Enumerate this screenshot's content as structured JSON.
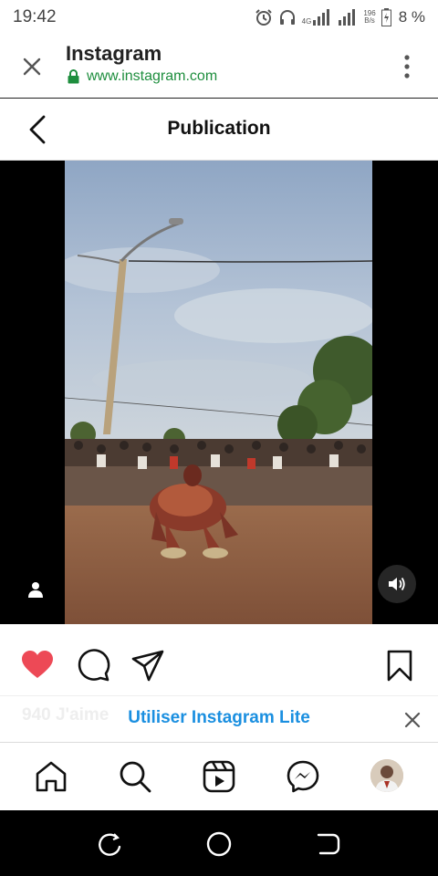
{
  "status_bar": {
    "time": "19:42",
    "network_type": "4G",
    "data_rate_top": "196",
    "data_rate_bottom": "B/s",
    "battery_percent": "8 %"
  },
  "browser": {
    "title": "Instagram",
    "url": "www.instagram.com",
    "icons": {
      "close": "close-icon",
      "secure": "lock-icon",
      "menu": "overflow-menu-icon"
    }
  },
  "page": {
    "title": "Publication",
    "back_icon": "chevron-left-icon"
  },
  "media": {
    "type": "video",
    "user_tag_icon": "person-icon",
    "sound_icon": "speaker-icon"
  },
  "actions": {
    "like_icon": "heart-icon",
    "like_state": "liked",
    "comment_icon": "comment-icon",
    "share_icon": "send-icon",
    "save_icon": "bookmark-icon",
    "like_color": "#ed4956"
  },
  "likes": {
    "count_text": "940 J'aime"
  },
  "lite_banner": {
    "link_text": "Utiliser Instagram Lite",
    "link_color": "#1a8fe0",
    "close_icon": "close-icon"
  },
  "bottom_nav": {
    "items": [
      "home-icon",
      "search-icon",
      "reels-icon",
      "messenger-icon",
      "profile-avatar"
    ]
  },
  "android_nav": {
    "items": [
      "recents-icon",
      "home-circle-icon",
      "back-icon"
    ]
  }
}
